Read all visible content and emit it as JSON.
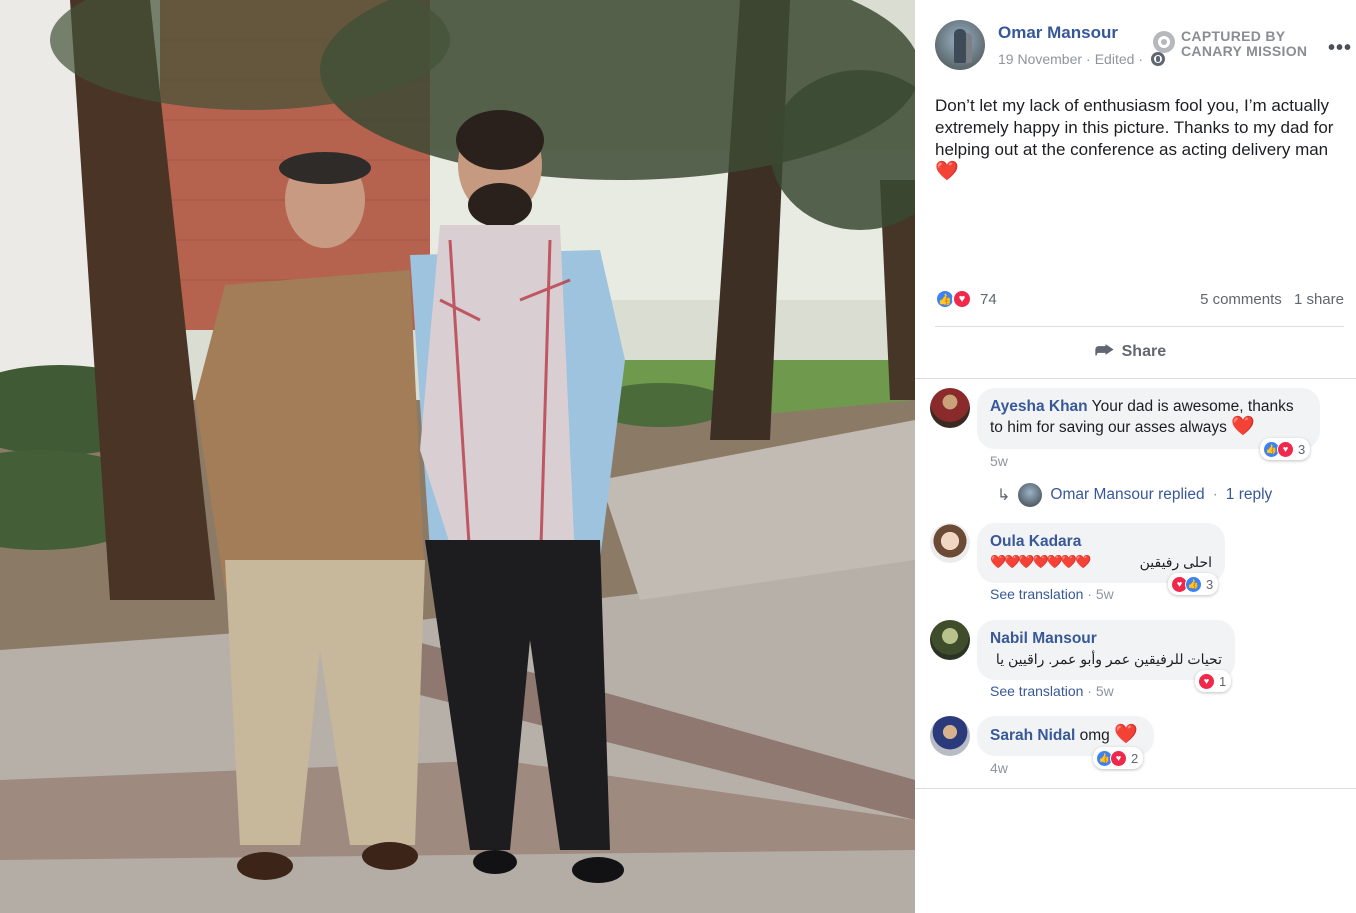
{
  "post": {
    "author": "Omar Mansour",
    "date": "19 November",
    "edited": "Edited",
    "separator": "·",
    "text": "Don’t let my lack of enthusiasm fool you, I’m actually extremely happy in this picture. Thanks to my dad for helping out at the conference as acting delivery man",
    "text_emoji": "❤️",
    "watermark_line1": "CAPTURED BY",
    "watermark_line2": "CANARY MISSION",
    "more_icon": "•••"
  },
  "stats": {
    "reaction_count": "74",
    "comments": "5 comments",
    "shares": "1 share"
  },
  "actions": {
    "share_label": "Share",
    "share_icon": "⮫"
  },
  "comments": [
    {
      "name": "Ayesha Khan",
      "text": "Your dad is awesome, thanks to him for saving our asses always",
      "emoji": "❤️",
      "time": "5w",
      "reaction_count": "3"
    },
    {
      "name": "Oula Kadara",
      "text": "احلى رفيقين",
      "emoji": "❤️❤️❤️❤️❤️❤️❤️",
      "see_translation": "See translation",
      "time": "5w",
      "reaction_count": "3"
    },
    {
      "name": "Nabil Mansour",
      "text": "تحيات للرفيقين عمر وأبو عمر. راقيين يا عم.",
      "see_translation": "See translation",
      "time": "5w",
      "reaction_count": "1"
    },
    {
      "name": "Sarah Nidal",
      "text": "omg",
      "emoji": "❤️",
      "time": "4w",
      "reaction_count": "2"
    }
  ],
  "reply": {
    "text": "Omar Mansour replied",
    "separator": "·",
    "count": "1 reply"
  },
  "colors": {
    "link_blue": "#385898",
    "like_blue": "#3b82f5",
    "love_red": "#f0284a",
    "bubble_bg": "#f2f3f5"
  }
}
